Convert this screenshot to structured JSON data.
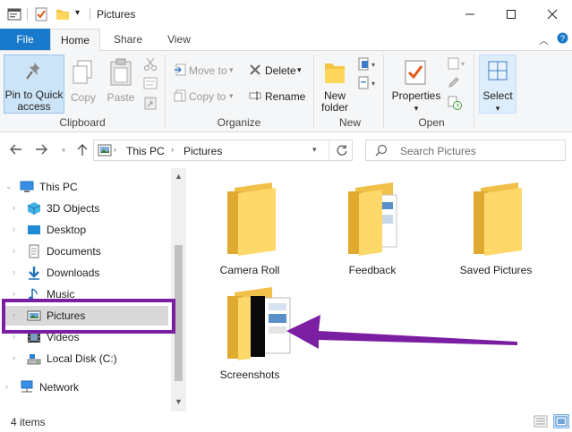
{
  "titlebar": {
    "title": "Pictures",
    "minimize_icon": "minimize-icon",
    "maximize_icon": "maximize-icon",
    "close_icon": "close-icon"
  },
  "tabs": [
    {
      "label": "File"
    },
    {
      "label": "Home"
    },
    {
      "label": "Share"
    },
    {
      "label": "View"
    }
  ],
  "ribbon": {
    "clipboard": {
      "pin_label_1": "Pin to Quick",
      "pin_label_2": "access",
      "copy_label": "Copy",
      "paste_label": "Paste",
      "group_label": "Clipboard"
    },
    "organize": {
      "move_to_label": "Move to",
      "copy_to_label": "Copy to",
      "delete_label": "Delete",
      "rename_label": "Rename",
      "group_label": "Organize"
    },
    "new": {
      "new_folder_label_1": "New",
      "new_folder_label_2": "folder",
      "group_label": "New"
    },
    "open": {
      "properties_label": "Properties",
      "group_label": "Open"
    },
    "select": {
      "select_label": "Select"
    }
  },
  "address": {
    "breadcrumb_1": "This PC",
    "breadcrumb_2": "Pictures",
    "search_placeholder": "Search Pictures"
  },
  "navpane": {
    "items": [
      {
        "label": "This PC",
        "icon": "computer-icon"
      },
      {
        "label": "3D Objects",
        "icon": "cube-icon"
      },
      {
        "label": "Desktop",
        "icon": "desktop-icon"
      },
      {
        "label": "Documents",
        "icon": "document-icon"
      },
      {
        "label": "Downloads",
        "icon": "download-icon"
      },
      {
        "label": "Music",
        "icon": "music-icon"
      },
      {
        "label": "Pictures",
        "icon": "picture-icon"
      },
      {
        "label": "Videos",
        "icon": "film-icon"
      },
      {
        "label": "Local Disk (C:)",
        "icon": "drive-icon"
      },
      {
        "label": "Network",
        "icon": "network-icon"
      }
    ]
  },
  "content": {
    "folders": [
      {
        "name": "Camera Roll"
      },
      {
        "name": "Feedback"
      },
      {
        "name": "Saved Pictures"
      },
      {
        "name": "Screenshots"
      }
    ]
  },
  "status": {
    "item_count": "4 items"
  },
  "colors": {
    "file_tab": "#1979ca",
    "folder_yellow": "#ffd65c",
    "annotation_purple": "#7b1fa2"
  }
}
